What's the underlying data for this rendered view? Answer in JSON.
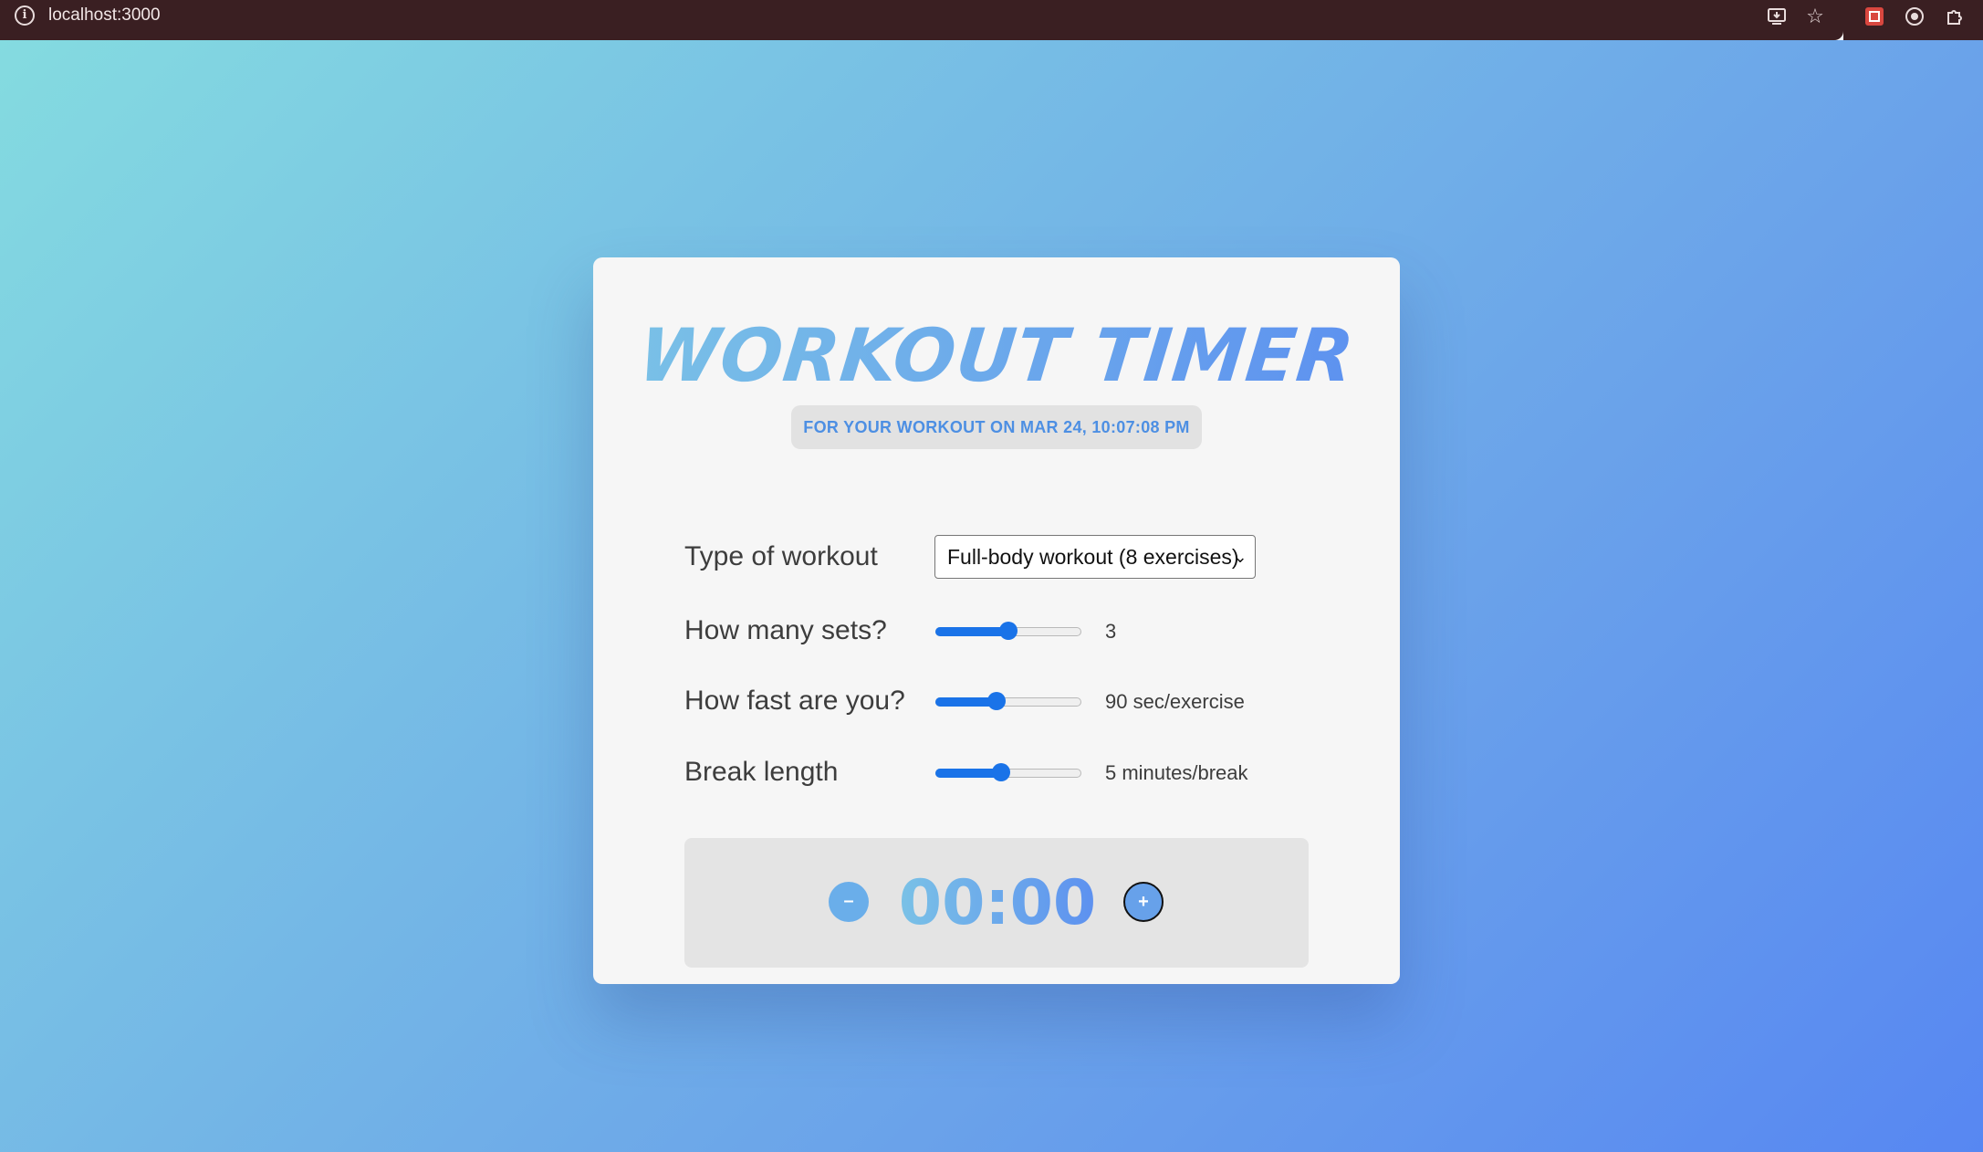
{
  "browser": {
    "url": "localhost:3000",
    "info_icon": "info-circle-icon",
    "toolbar_icons": [
      "install-app-icon",
      "bookmark-star-icon",
      "extension-red-icon",
      "record-icon",
      "extensions-puzzle-icon"
    ]
  },
  "app": {
    "title": "WORKOUT TIMER",
    "subtitle": "FOR YOUR WORKOUT ON MAR 24, 10:07:08 PM"
  },
  "settings": {
    "workout_type": {
      "label": "Type of workout",
      "selected": "Full-body workout (8 exercises)"
    },
    "sets": {
      "label": "How many sets?",
      "value_text": "3",
      "fraction": 0.5
    },
    "speed": {
      "label": "How fast are you?",
      "value_text": "90 sec/exercise",
      "fraction": 0.42
    },
    "break": {
      "label": "Break length",
      "value_text": "5 minutes/break",
      "fraction": 0.45
    }
  },
  "timer": {
    "display": "00:00",
    "minus_label": "–",
    "plus_label": "+"
  },
  "colors": {
    "accent_blue": "#1a73e8",
    "gradient_start": "#7bc3e6",
    "gradient_end": "#5c8ff0",
    "subtitle_text": "#4d8fe3"
  }
}
